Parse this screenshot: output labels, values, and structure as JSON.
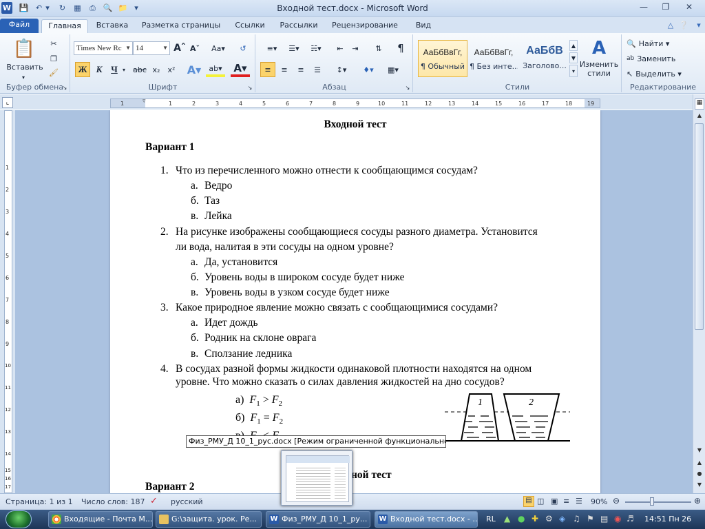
{
  "window": {
    "title": "Входной тест.docx - Microsoft Word",
    "app_icon": "word-logo-icon",
    "quick_access": [
      "save-icon",
      "undo-icon",
      "undo-dropdown-icon",
      "repeat-icon",
      "print-preview-icon",
      "print-icon",
      "quick-print-icon",
      "open-folder-icon",
      "customize-qat-icon"
    ]
  },
  "tabs": [
    "Файл",
    "Главная",
    "Вставка",
    "Разметка страницы",
    "Ссылки",
    "Рассылки",
    "Рецензирование",
    "Вид"
  ],
  "ribbon": {
    "clipboard": {
      "paste": "Вставить",
      "label": "Буфер обмена"
    },
    "font": {
      "name": "Times New Rc",
      "size": "14",
      "label": "Шрифт",
      "bold": "Ж",
      "italic": "К",
      "underline": "Ч",
      "strike": "abc",
      "sub": "x₂",
      "sup": "x²",
      "case": "Aa"
    },
    "paragraph": {
      "label": "Абзац"
    },
    "styles": {
      "items": [
        {
          "sample": "АаБбВвГг,",
          "name": "¶ Обычный"
        },
        {
          "sample": "АаБбВвГг,",
          "name": "¶ Без инте..."
        },
        {
          "sample": "АаБбВ",
          "name": "Заголово..."
        }
      ],
      "change": "Изменить стили",
      "label": "Стили"
    },
    "editing": {
      "find": "Найти",
      "replace": "Заменить",
      "select": "Выделить",
      "label": "Редактирование"
    }
  },
  "ruler": [
    "1",
    "1",
    "2",
    "3",
    "4",
    "5",
    "6",
    "7",
    "8",
    "9",
    "10",
    "11",
    "12",
    "13",
    "14",
    "15",
    "16",
    "17",
    "18",
    "19"
  ],
  "vruler": [
    "1",
    "2",
    "3",
    "4",
    "5",
    "6",
    "7",
    "8",
    "9",
    "10",
    "11",
    "12",
    "13",
    "14",
    "15",
    "16",
    "17"
  ],
  "document": {
    "title": "Входной тест",
    "variant1": "Вариант 1",
    "q": [
      {
        "n": "1.",
        "lines": [
          "Что из перечисленного можно отнести к сообщающимся сосудам?"
        ],
        "answers": [
          [
            "а.",
            "Ведро"
          ],
          [
            "б.",
            "Таз"
          ],
          [
            "в.",
            "Лейка"
          ]
        ]
      },
      {
        "n": "2.",
        "lines": [
          "На рисунке изображены сообщающиеся сосуды разного диаметра. Установится",
          "ли вода, налитая в эти сосуды на одном уровне?"
        ],
        "answers": [
          [
            "а.",
            "Да, установится"
          ],
          [
            "б.",
            "Уровень воды в широком сосуде будет ниже"
          ],
          [
            "в.",
            "Уровень воды в узком сосуде будет ниже"
          ]
        ]
      },
      {
        "n": "3.",
        "lines": [
          "Какое природное явление можно связать с сообщающимися сосудами?"
        ],
        "answers": [
          [
            "а.",
            "Идет дождь"
          ],
          [
            "б.",
            "Родник на склоне оврага"
          ],
          [
            "в.",
            "Сползание ледника"
          ]
        ]
      },
      {
        "n": "4.",
        "lines": [
          "В сосудах разной формы жидкости одинаковой плотности находятся на одном",
          "уровне. Что можно сказать о силах давления жидкостей на дно сосудов?"
        ],
        "answers": []
      }
    ],
    "formulas": [
      [
        "а)",
        "F",
        "1",
        ">",
        "F",
        "2"
      ],
      [
        "б)",
        "F",
        "1",
        "=",
        "F",
        "2"
      ],
      [
        "в)",
        "F",
        "1",
        "<",
        "F",
        "2"
      ]
    ],
    "vessel_labels": [
      "1",
      "2"
    ],
    "title2_tail": "ной тест",
    "variant2": "Вариант 2"
  },
  "status": {
    "page": "Страница: 1 из 1",
    "words": "Число слов: 187",
    "lang": "русский",
    "zoom": "90%"
  },
  "tooltip": "Физ_РМУ_Д 10_1_рус.docx [Режим ограниченной функциональности] - ...",
  "taskbar": {
    "items": [
      "Входящие - Почта M...",
      "G:\\защита. урок. Ре...",
      "Физ_РМУ_Д 10_1_ру...",
      "Входной тест.docx - ..."
    ],
    "tray_lang": "RL",
    "clock": "14:51 Пн 26"
  }
}
